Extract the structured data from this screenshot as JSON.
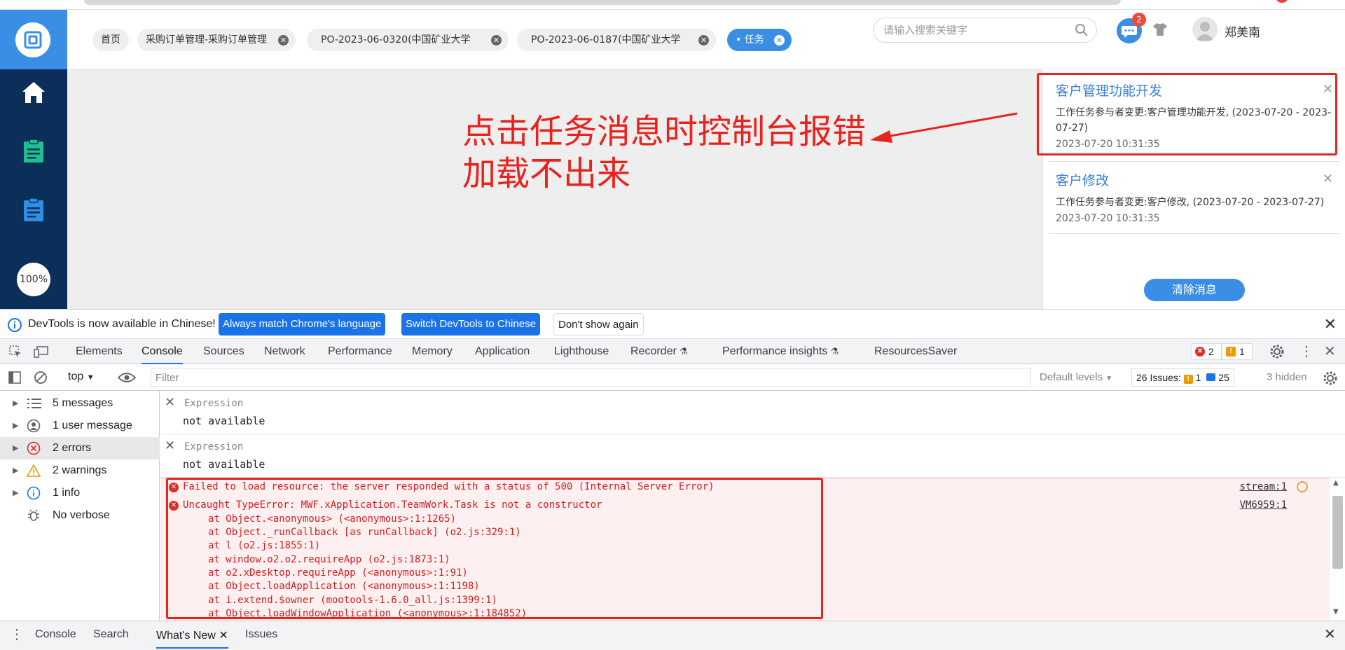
{
  "app": {
    "tabs": [
      {
        "label": "首页"
      },
      {
        "label": "采购订单管理-采购订单管理"
      },
      {
        "label": "PO-2023-06-0320(中国矿业大学"
      },
      {
        "label": "PO-2023-06-0187(中国矿业大学"
      },
      {
        "label": "• 任务"
      }
    ],
    "search_placeholder": "请输入搜索关键字",
    "message_badge": "2",
    "username": "郑美南",
    "zoom_label": "100%",
    "annotation": [
      "点击任务消息时控制台报错",
      "加载不出来"
    ],
    "notifications": [
      {
        "title": "客户管理功能开发",
        "body": "工作任务参与者变更:客户管理功能开发, (2023-07-20 - 2023-07-27)",
        "time": "2023-07-20 10:31:35"
      },
      {
        "title": "客户修改",
        "body": "工作任务参与者变更:客户修改, (2023-07-20 - 2023-07-27)",
        "time": "2023-07-20 10:31:35"
      }
    ],
    "clear_label": "清除消息",
    "colors": {
      "sidebar": "#0b2f58",
      "accent": "#3a8ee6",
      "annotation": "#e8231e"
    }
  },
  "devtools": {
    "infobar": {
      "message": "DevTools is now available in Chinese!",
      "btn_match": "Always match Chrome's language",
      "btn_switch": "Switch DevTools to Chinese",
      "btn_dismiss": "Don't show again"
    },
    "tabs": [
      "Elements",
      "Console",
      "Sources",
      "Network",
      "Performance",
      "Memory",
      "Application",
      "Lighthouse",
      "Recorder",
      "Performance insights",
      "ResourcesSaver"
    ],
    "error_count": "2",
    "warning_count": "1",
    "context": "top",
    "filter_placeholder": "Filter",
    "levels": "Default levels",
    "issues_label": "26 Issues:",
    "issues_warn": "1",
    "issues_info": "25",
    "hidden": "3 hidden",
    "sidebar": [
      {
        "label": "5 messages"
      },
      {
        "label": "1 user message"
      },
      {
        "label": "2 errors"
      },
      {
        "label": "2 warnings"
      },
      {
        "label": "1 info"
      },
      {
        "label": "No verbose"
      }
    ],
    "expressions": [
      {
        "key": "Expression",
        "value": "not available"
      },
      {
        "key": "Expression",
        "value": "not available"
      }
    ],
    "errors": {
      "e1": "Failed to load resource: the server responded with a status of 500 (Internal Server Error)",
      "e1_src": "stream:1",
      "e2": "Uncaught TypeError: MWF.xApplication.TeamWork.Task is not a constructor",
      "e2_src": "VM6959:1",
      "stack": [
        "at Object.<anonymous> (<anonymous>:1:1265)",
        "at Object._runCallback [as runCallback] (o2.js:329:1)",
        "at l (o2.js:1855:1)",
        "at window.o2.o2.requireApp (o2.js:1873:1)",
        "at o2.xDesktop.requireApp (<anonymous>:1:91)",
        "at Object.loadApplication (<anonymous>:1:1198)",
        "at i.extend.$owner (mootools-1.6.0_all.js:1399:1)",
        "at Object.loadWindowApplication (<anonymous>:1:184852)"
      ]
    },
    "drawer": [
      "Console",
      "Search",
      "What's New",
      "Issues"
    ]
  }
}
